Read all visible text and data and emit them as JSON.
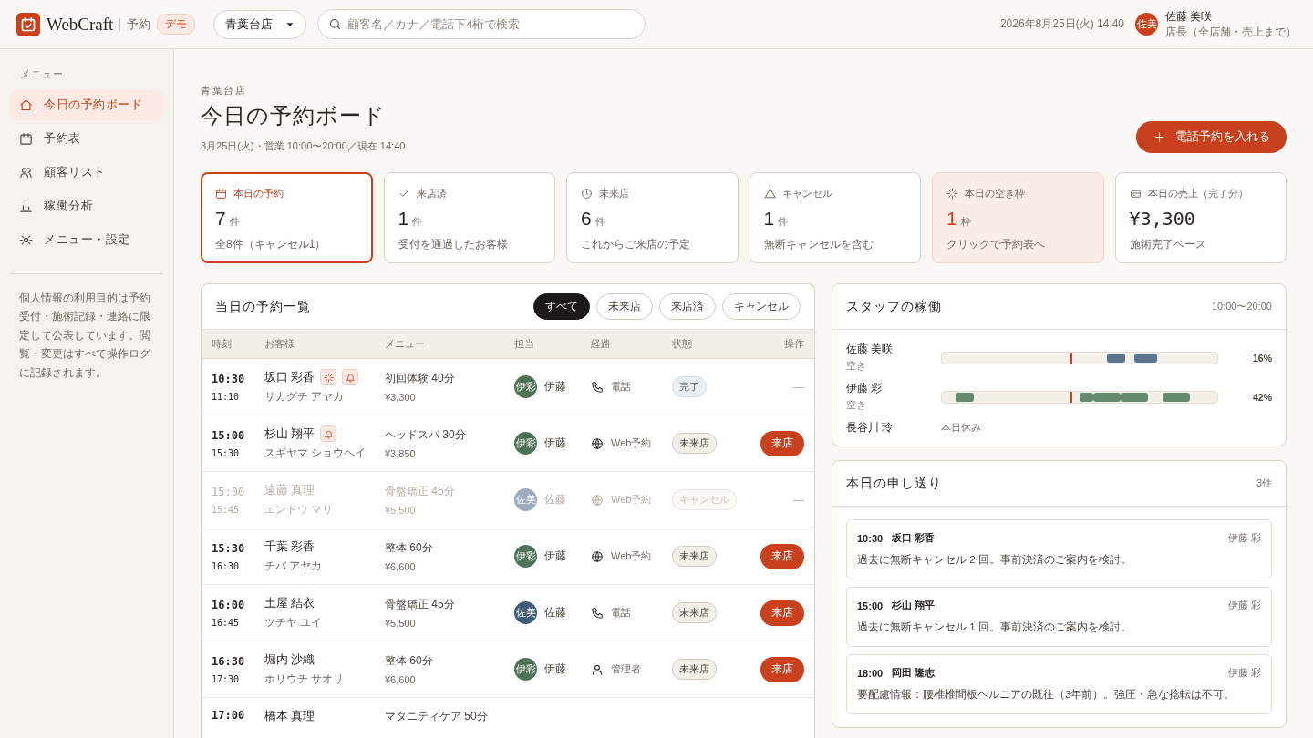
{
  "header": {
    "brand": "WebCraft",
    "product": "予約",
    "badge": "デモ",
    "store_select": "青葉台店",
    "search": {
      "placeholder": "顧客名／カナ／電話下4桁で検索"
    },
    "datetime": "2026年8月25日(火) 14:40",
    "user": {
      "initials": "佐美",
      "name": "佐藤 美咲",
      "role": "店長（全店舗・売上まで）"
    }
  },
  "sidebar": {
    "heading": "メニュー",
    "items": [
      {
        "label": "今日の予約ボード",
        "selected": true
      },
      {
        "label": "予約表",
        "selected": false
      },
      {
        "label": "顧客リスト",
        "selected": false
      },
      {
        "label": "稼働分析",
        "selected": false
      },
      {
        "label": "メニュー・設定",
        "selected": false
      }
    ],
    "note": "個人情報の利用目的は予約受付・施術記録・連絡に限定して公表しています。閲覧・変更はすべて操作ログに記録されます。"
  },
  "page": {
    "store": "青葉台店",
    "title": "今日の予約ボード",
    "subtitle": "8月25日(火)・営業 10:00〜20:00／現在 14:40",
    "primary_button": "電話予約を入れる"
  },
  "stats": [
    {
      "kind": "reservations",
      "label": "本日の予約",
      "value": "7",
      "unit": "件",
      "note": "全8件（キャンセル1）",
      "selected": true
    },
    {
      "kind": "visited",
      "label": "来店済",
      "value": "1",
      "unit": "件",
      "note": "受付を通過したお客様",
      "selected": false
    },
    {
      "kind": "pending",
      "label": "未来店",
      "value": "6",
      "unit": "件",
      "note": "これからご来店の予定",
      "selected": false
    },
    {
      "kind": "cancel",
      "label": "キャンセル",
      "value": "1",
      "unit": "件",
      "note": "無断キャンセルを含む",
      "selected": false
    },
    {
      "kind": "vacancy",
      "label": "本日の空き枠",
      "value": "1",
      "unit": "枠",
      "note": "クリックで予約表へ",
      "selected": false
    },
    {
      "kind": "sales",
      "label": "本日の売上（完了分）",
      "value": "¥3,300",
      "note": "施術完了ベース",
      "selected": false
    }
  ],
  "reservations": {
    "title": "当日の予約一覧",
    "filters": [
      {
        "label": "すべて",
        "selected": true
      },
      {
        "label": "未来店",
        "selected": false
      },
      {
        "label": "来店済",
        "selected": false
      },
      {
        "label": "キャンセル",
        "selected": false
      }
    ],
    "columns": [
      "時刻",
      "お客様",
      "メニュー",
      "担当",
      "経路",
      "状態",
      "操作"
    ],
    "rows": [
      {
        "start": "10:30",
        "end": "11:10",
        "name": "坂口 彩香",
        "kana": "サカグチ アヤカ",
        "care": true,
        "reminder": true,
        "menu": "初回体験 40分",
        "price": "¥3,300",
        "staff": {
          "initials": "伊彩",
          "name": "伊藤",
          "color": "#4e7358"
        },
        "route": {
          "kind": "phone",
          "label": "電話"
        },
        "status": {
          "kind": "done",
          "label": "完了"
        },
        "action": "—"
      },
      {
        "start": "15:00",
        "end": "15:30",
        "name": "杉山 翔平",
        "kana": "スギヤマ ショウヘイ",
        "care": false,
        "reminder": true,
        "menu": "ヘッドスパ 30分",
        "price": "¥3,850",
        "staff": {
          "initials": "伊彩",
          "name": "伊藤",
          "color": "#4e7358"
        },
        "route": {
          "kind": "web",
          "label": "Web予約"
        },
        "status": {
          "kind": "pending",
          "label": "未来店"
        },
        "action": "来店"
      },
      {
        "start": "15:00",
        "end": "15:45",
        "name": "遠藤 真理",
        "kana": "エンドウ マリ",
        "care": false,
        "reminder": false,
        "menu": "骨盤矯正 45分",
        "price": "¥5,500",
        "staff": {
          "initials": "佐美",
          "name": "佐藤",
          "color": "#9aabbd"
        },
        "route": {
          "kind": "web",
          "label": "Web予約"
        },
        "status": {
          "kind": "cancelled",
          "label": "キャンセル"
        },
        "action": "—"
      },
      {
        "start": "15:30",
        "end": "16:30",
        "name": "千葉 彩香",
        "kana": "チバ アヤカ",
        "care": false,
        "reminder": false,
        "menu": "整体 60分",
        "price": "¥6,600",
        "staff": {
          "initials": "伊彩",
          "name": "伊藤",
          "color": "#4e7358"
        },
        "route": {
          "kind": "web",
          "label": "Web予約"
        },
        "status": {
          "kind": "pending",
          "label": "未来店"
        },
        "action": "来店"
      },
      {
        "start": "16:00",
        "end": "16:45",
        "name": "土屋 結衣",
        "kana": "ツチヤ ユイ",
        "care": false,
        "reminder": false,
        "menu": "骨盤矯正 45分",
        "price": "¥5,500",
        "staff": {
          "initials": "佐美",
          "name": "佐藤",
          "color": "#3f5c7a"
        },
        "route": {
          "kind": "phone",
          "label": "電話"
        },
        "status": {
          "kind": "pending",
          "label": "未来店"
        },
        "action": "来店"
      },
      {
        "start": "16:30",
        "end": "17:30",
        "name": "堀内 沙織",
        "kana": "ホリウチ サオリ",
        "care": false,
        "reminder": false,
        "menu": "整体 60分",
        "price": "¥6,600",
        "staff": {
          "initials": "伊彩",
          "name": "伊藤",
          "color": "#4e7358"
        },
        "route": {
          "kind": "admin",
          "label": "管理者"
        },
        "status": {
          "kind": "pending",
          "label": "未来店"
        },
        "action": "来店"
      },
      {
        "kind": "partial",
        "start": "17:00",
        "name": "橋本 真理",
        "care": false,
        "reminder": false,
        "menu": "マタニティケア 50分"
      }
    ]
  },
  "staff_utilization": {
    "title": "スタッフの稼働",
    "hours": "10:00〜20:00",
    "staff": [
      {
        "kind": "working",
        "name": "佐藤 美咲",
        "state": "空き",
        "percent": "16%",
        "color": "#5b7590"
      },
      {
        "kind": "working",
        "name": "伊藤 彩",
        "state": "空き",
        "percent": "42%",
        "color": "#668a6e"
      },
      {
        "kind": "off",
        "name": "長谷川 玲",
        "state": "本日休み"
      }
    ]
  },
  "handover": {
    "title": "本日の申し送り",
    "count": "3件",
    "notes": [
      {
        "time": "10:30",
        "name": "坂口 彩香",
        "staff": "伊藤 彩",
        "text": "過去に無断キャンセル 2 回。事前決済のご案内を検討。"
      },
      {
        "time": "15:00",
        "name": "杉山 翔平",
        "staff": "伊藤 彩",
        "text": "過去に無断キャンセル 1 回。事前決済のご案内を検討。"
      },
      {
        "time": "18:00",
        "name": "岡田 隆志",
        "staff": "伊藤 彩",
        "text": "要配慮情報：腰椎椎間板ヘルニアの既往（3年前）。強圧・急な捻転は不可。"
      }
    ]
  }
}
